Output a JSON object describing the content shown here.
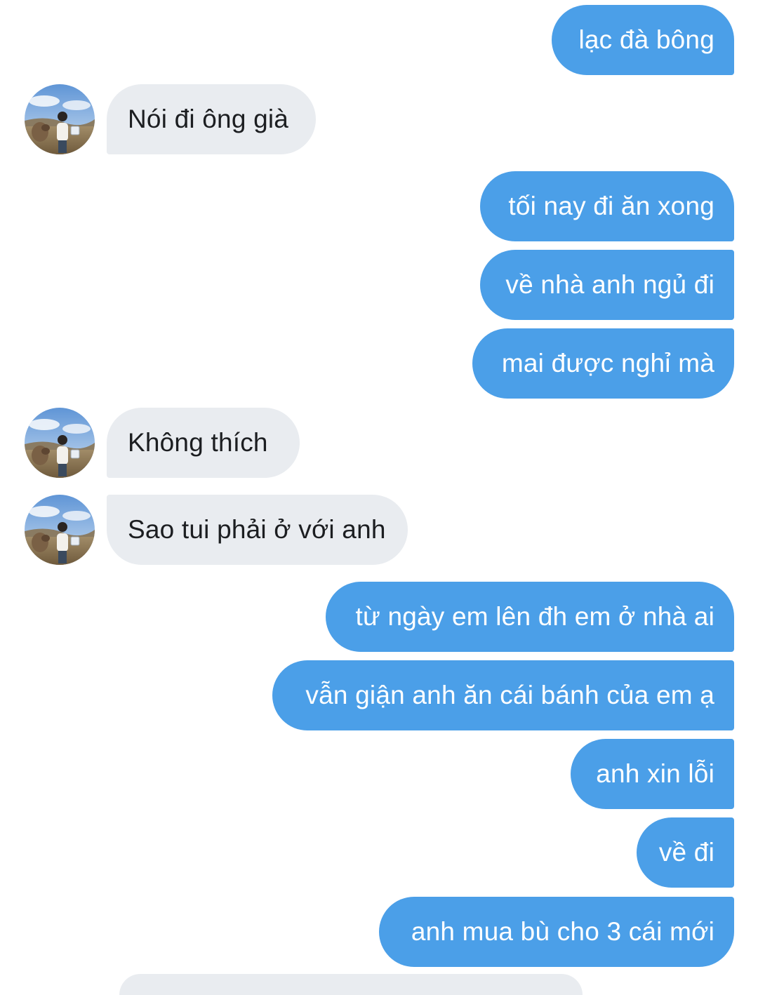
{
  "conversation": {
    "messages": [
      {
        "from": "me",
        "text": "lạc đà bông"
      },
      {
        "from": "them",
        "text": "Nói đi ông già"
      },
      {
        "from": "me",
        "text": "tối nay đi ăn xong"
      },
      {
        "from": "me",
        "text": "về nhà anh ngủ đi"
      },
      {
        "from": "me",
        "text": "mai được nghỉ mà"
      },
      {
        "from": "them",
        "text": "Không thích"
      },
      {
        "from": "them",
        "text": "Sao tui phải ở với anh"
      },
      {
        "from": "me",
        "text": "từ ngày em lên đh em ở nhà ai"
      },
      {
        "from": "me",
        "text": "vẫn giận anh ăn cái bánh của em ạ"
      },
      {
        "from": "me",
        "text": "anh xin lỗi"
      },
      {
        "from": "me",
        "text": "về đi"
      },
      {
        "from": "me",
        "text": "anh mua bù cho 3 cái mới"
      }
    ]
  },
  "colors": {
    "outgoing_bubble": "#4b9fe8",
    "incoming_bubble": "#e9ecf0",
    "outgoing_text": "#ffffff",
    "incoming_text": "#1c1e21",
    "background": "#ffffff"
  },
  "icons": {
    "contact_avatar": "avatar-photo"
  }
}
